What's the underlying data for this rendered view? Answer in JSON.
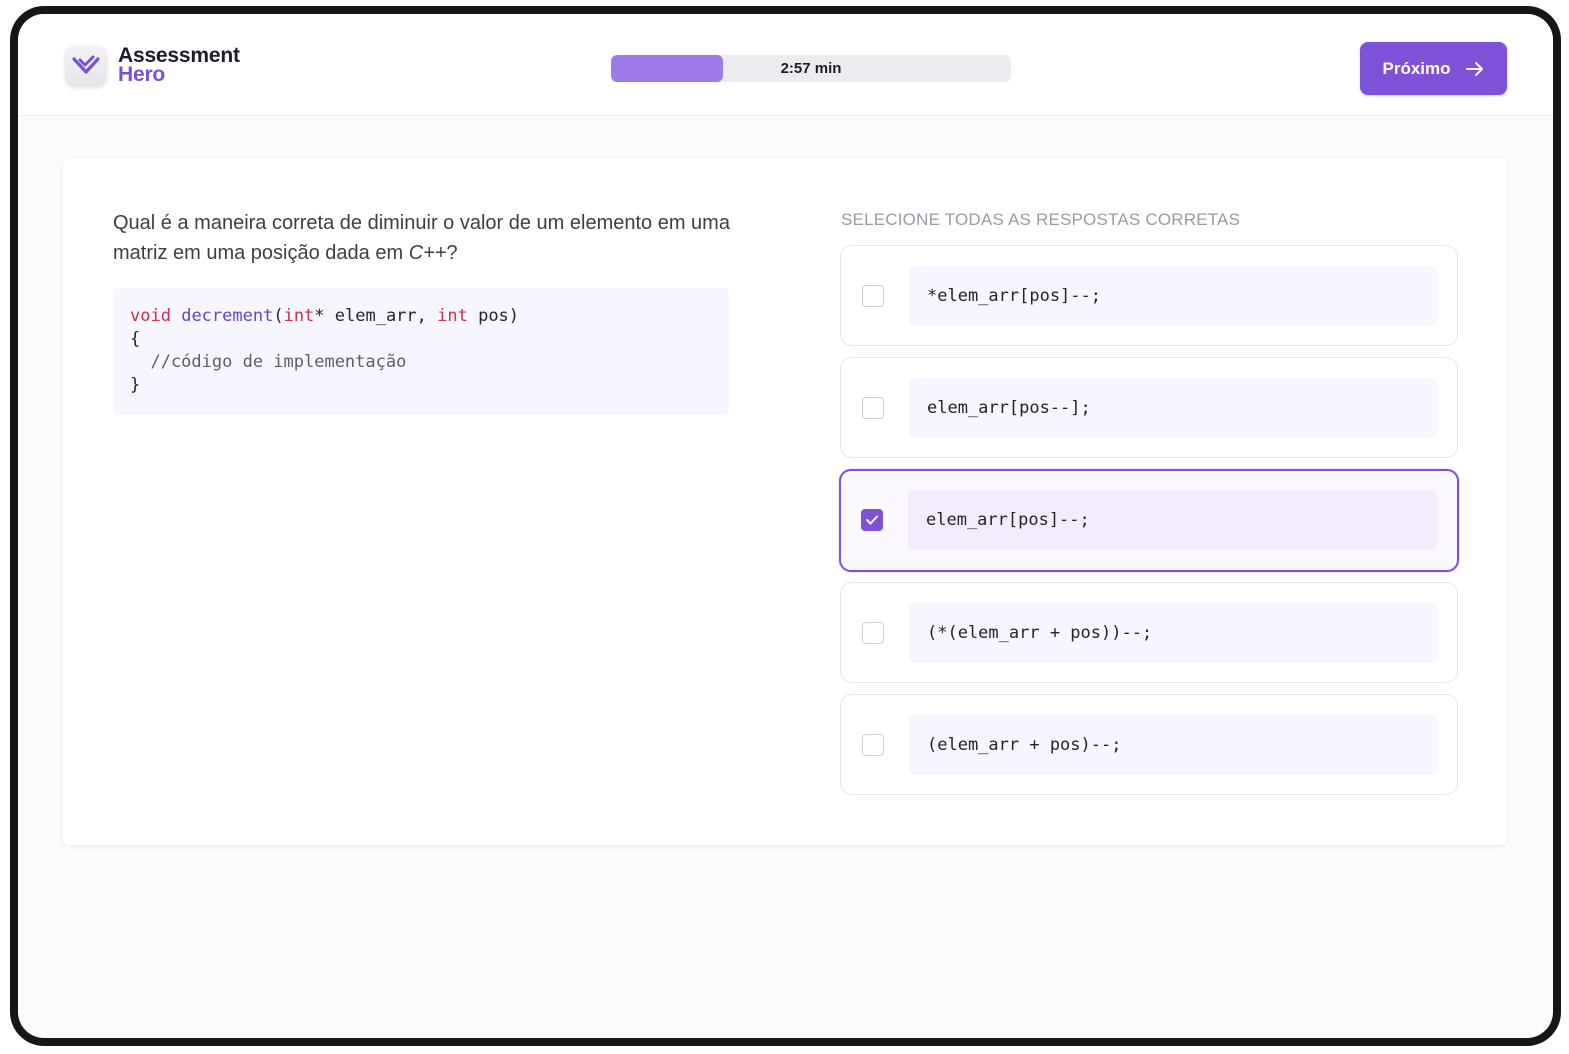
{
  "brand": {
    "line1": "Assessment",
    "line2": "Hero",
    "icon": "heart-check-icon"
  },
  "timer": {
    "text": "2:57 min",
    "progress_fraction": 0.28,
    "fill_color": "#9d7be9"
  },
  "header": {
    "next_label": "Próximo",
    "next_icon": "arrow-right-icon"
  },
  "question": {
    "text_before": "Qual é a maneira correta de diminuir o valor de um elemento em uma matriz em uma posição dada em ",
    "language": "C++",
    "text_after": "?"
  },
  "code": {
    "kw_void": "void",
    "fn_name": "decrement",
    "paren_open": "(",
    "kw_int1": "int",
    "param1": "* elem_arr, ",
    "kw_int2": "int",
    "param2": " pos)",
    "brace_open": "{",
    "comment": "  //código de implementação",
    "brace_close": "}"
  },
  "instructions": "SELECIONE TODAS AS RESPOSTAS CORRETAS",
  "options": [
    {
      "code": "*elem_arr[pos]--;",
      "checked": false
    },
    {
      "code": "elem_arr[pos--];",
      "checked": false
    },
    {
      "code": "elem_arr[pos]--;",
      "checked": true
    },
    {
      "code": "(*(elem_arr + pos))--;",
      "checked": false
    },
    {
      "code": "(elem_arr + pos)--;",
      "checked": false
    }
  ],
  "colors": {
    "accent": "#7e52d8",
    "code_bg": "#f7f5fd",
    "keyword": "#c8324e",
    "function": "#6a44c9"
  }
}
